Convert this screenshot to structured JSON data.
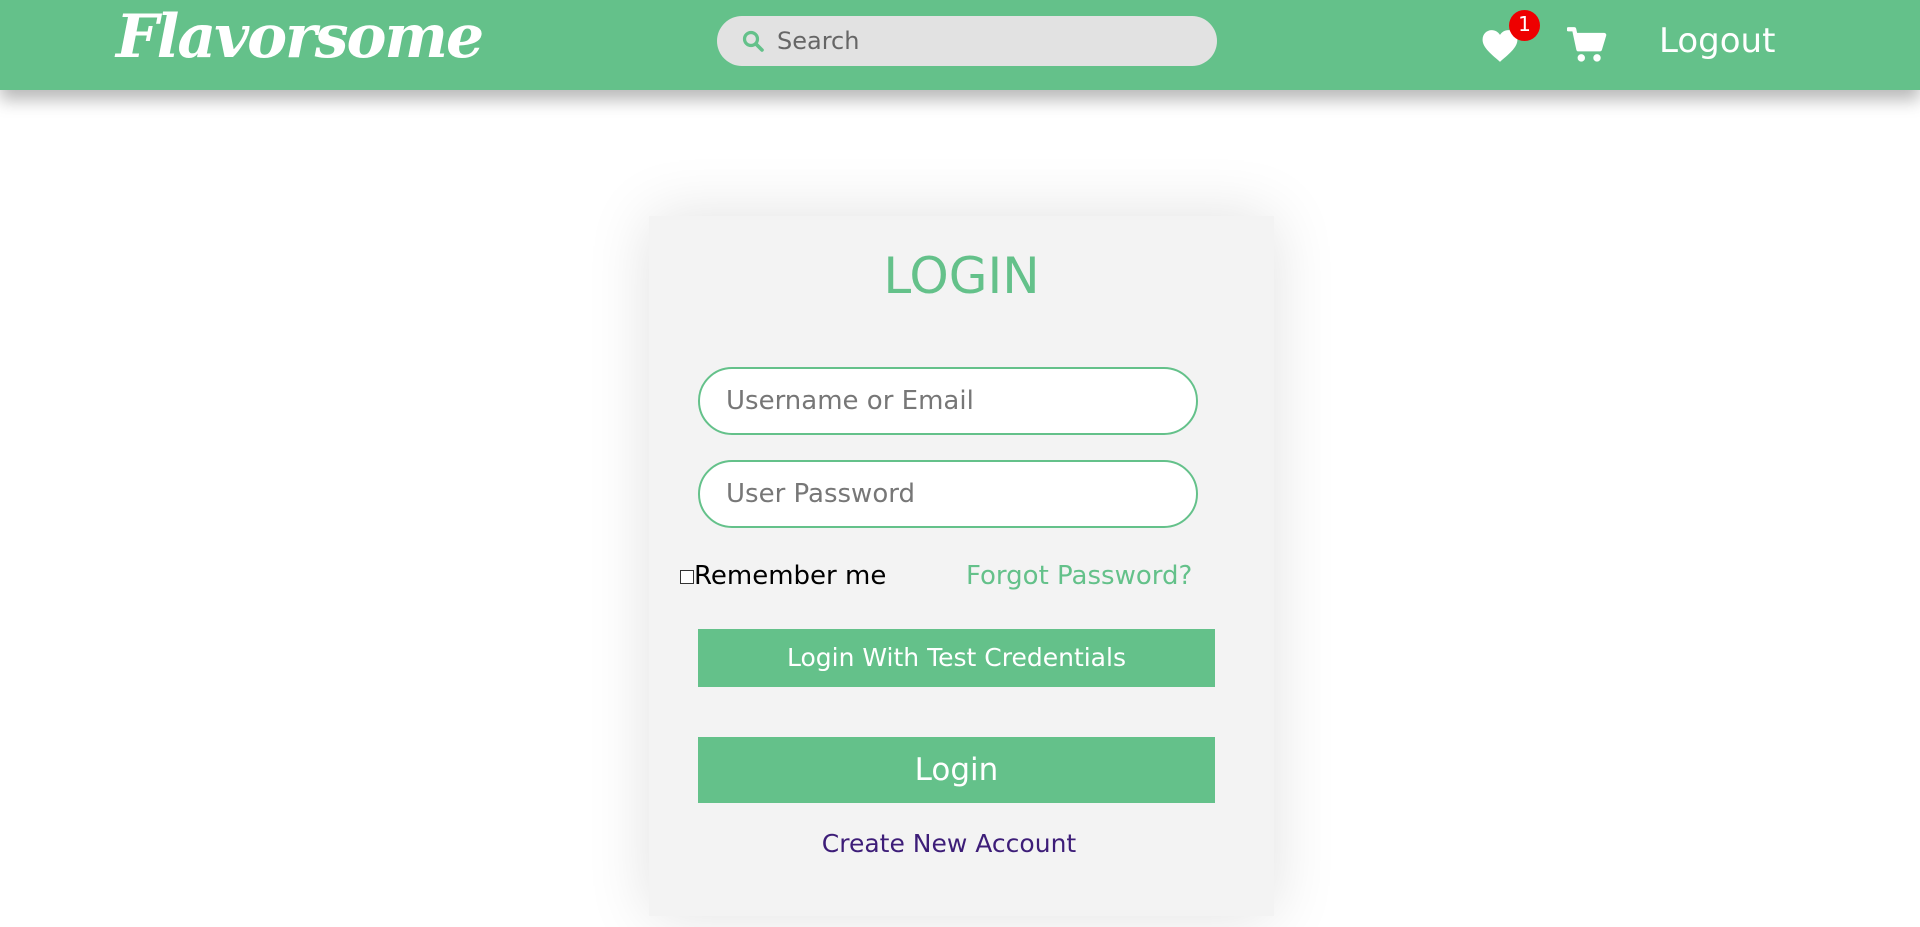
{
  "navbar": {
    "brand": "Flavorsome",
    "search_placeholder": "Search",
    "wishlist_count": "1",
    "logout_label": "Logout"
  },
  "login": {
    "title": "LOGIN",
    "username_placeholder": "Username or Email",
    "password_placeholder": "User Password",
    "remember_label": "Remember me",
    "forgot_label": "Forgot Password?",
    "test_login_label": "Login With Test Credentials",
    "login_label": "Login",
    "create_account_label": "Create New Account"
  },
  "colors": {
    "accent": "#64c18a",
    "badge": "#ee0000",
    "link": "#3d1d78"
  },
  "icons": [
    "search-icon",
    "heart-icon",
    "cart-icon"
  ]
}
